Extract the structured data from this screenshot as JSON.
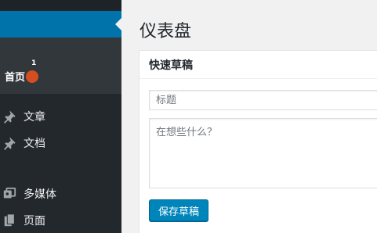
{
  "sidebar": {
    "submenu_item": "首页",
    "update_badge_count": "1",
    "items": [
      {
        "label": "文章",
        "icon": "pin-icon"
      },
      {
        "label": "文档",
        "icon": "pin-icon"
      },
      {
        "label": "多媒体",
        "icon": "media-icon"
      },
      {
        "label": "页面",
        "icon": "page-icon"
      }
    ]
  },
  "main": {
    "page_title": "仪表盘",
    "quick_draft": {
      "title": "快速草稿",
      "title_placeholder": "标题",
      "content_placeholder": "在想些什么？",
      "save_label": "保存草稿"
    }
  },
  "colors": {
    "sidebar_bg": "#23282d",
    "active_blue": "#0073aa",
    "badge": "#d54e21",
    "button": "#0085ba"
  }
}
